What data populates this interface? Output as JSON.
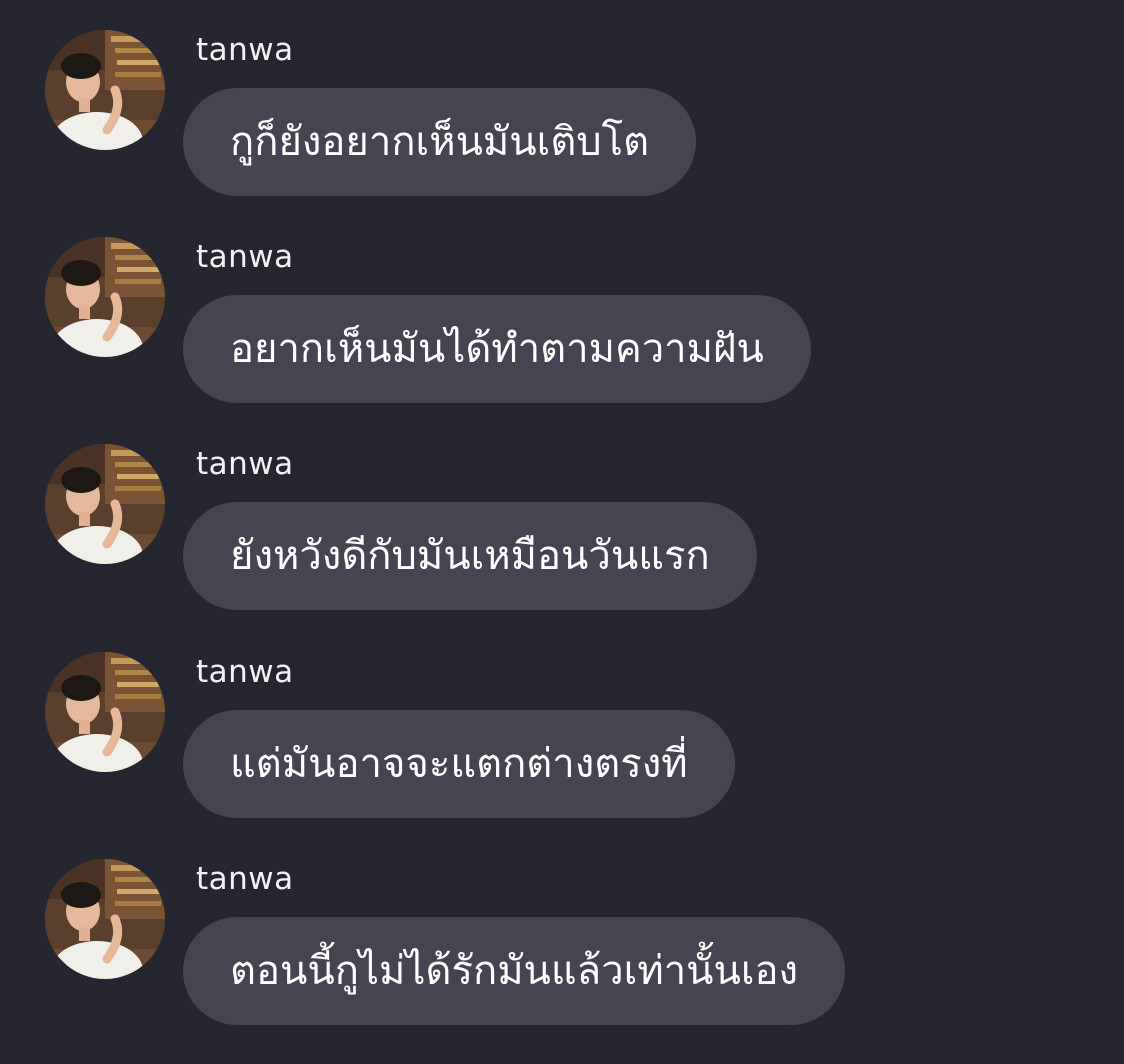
{
  "messages": [
    {
      "sender": "tanwa",
      "text": "กูก็ยังอยากเห็นมันเติบโต",
      "avatar_icon": "profile-photo"
    },
    {
      "sender": "tanwa",
      "text": "อยากเห็นมันได้ทำตามความฝัน",
      "avatar_icon": "profile-photo"
    },
    {
      "sender": "tanwa",
      "text": "ยังหวังดีกับมันเหมือนวันแรก",
      "avatar_icon": "profile-photo"
    },
    {
      "sender": "tanwa",
      "text": "แต่มันอาจจะแตกต่างตรงที่",
      "avatar_icon": "profile-photo"
    },
    {
      "sender": "tanwa",
      "text": "ตอนนี้กูไม่ได้รักมันแล้วเท่านั้นเอง",
      "avatar_icon": "profile-photo"
    }
  ],
  "colors": {
    "background": "#25262f",
    "bubble": "#444550",
    "text": "#ffffff",
    "sender": "#f2f2f4"
  }
}
